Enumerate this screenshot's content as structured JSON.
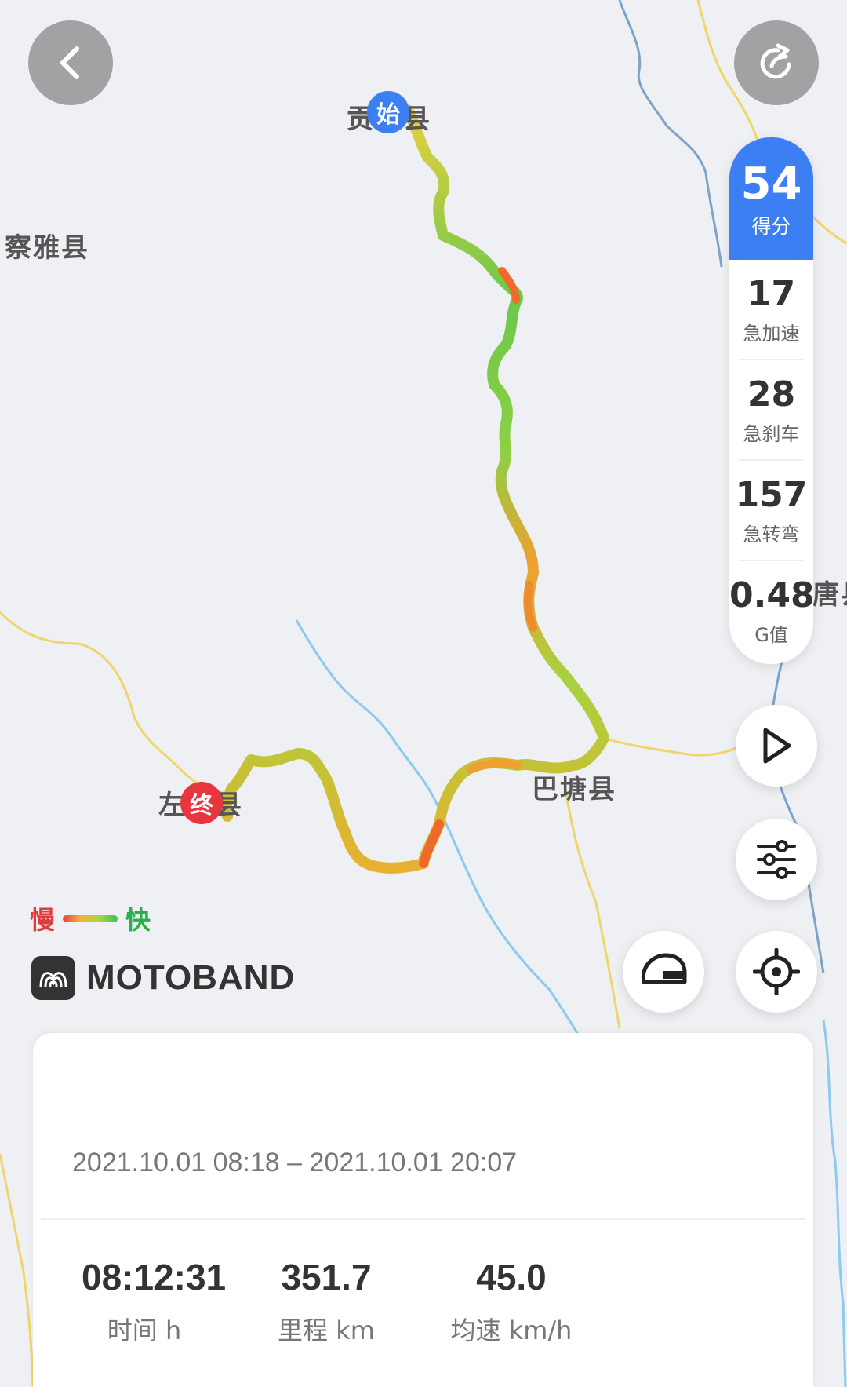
{
  "map": {
    "places": {
      "gongjue": "贡觉县",
      "chaya": "察雅县",
      "batang": "巴塘县",
      "zuogong": "左贡县",
      "tang": "唐县"
    },
    "start_marker": "始",
    "end_marker": "终"
  },
  "buttons": {
    "back_icon": "chevron-left-icon",
    "share_icon": "share-icon",
    "play_icon": "play-icon",
    "settings_icon": "sliders-icon",
    "helmet_icon": "helmet-icon",
    "locate_icon": "locate-icon"
  },
  "score_panel": {
    "score": "54",
    "score_label": "得分",
    "stats": [
      {
        "value": "17",
        "label": "急加速"
      },
      {
        "value": "28",
        "label": "急刹车"
      },
      {
        "value": "157",
        "label": "急转弯"
      },
      {
        "value": "0.48",
        "label": "G值"
      }
    ]
  },
  "legend": {
    "slow": "慢",
    "fast": "快"
  },
  "brand": {
    "name": "MOTOBAND"
  },
  "trip": {
    "time_range": "2021.10.01 08:18 – 2021.10.01 20:07",
    "metrics": [
      {
        "value": "08:12:31",
        "label": "时间 h"
      },
      {
        "value": "351.7",
        "label": "里程 km"
      },
      {
        "value": "45.0",
        "label": "均速 km/h"
      }
    ]
  },
  "colors": {
    "accent": "#3b7ff2",
    "start": "#3b7ff2",
    "end": "#e8363f",
    "route_fast": "#5cc545",
    "route_slow": "#f08a2a"
  }
}
